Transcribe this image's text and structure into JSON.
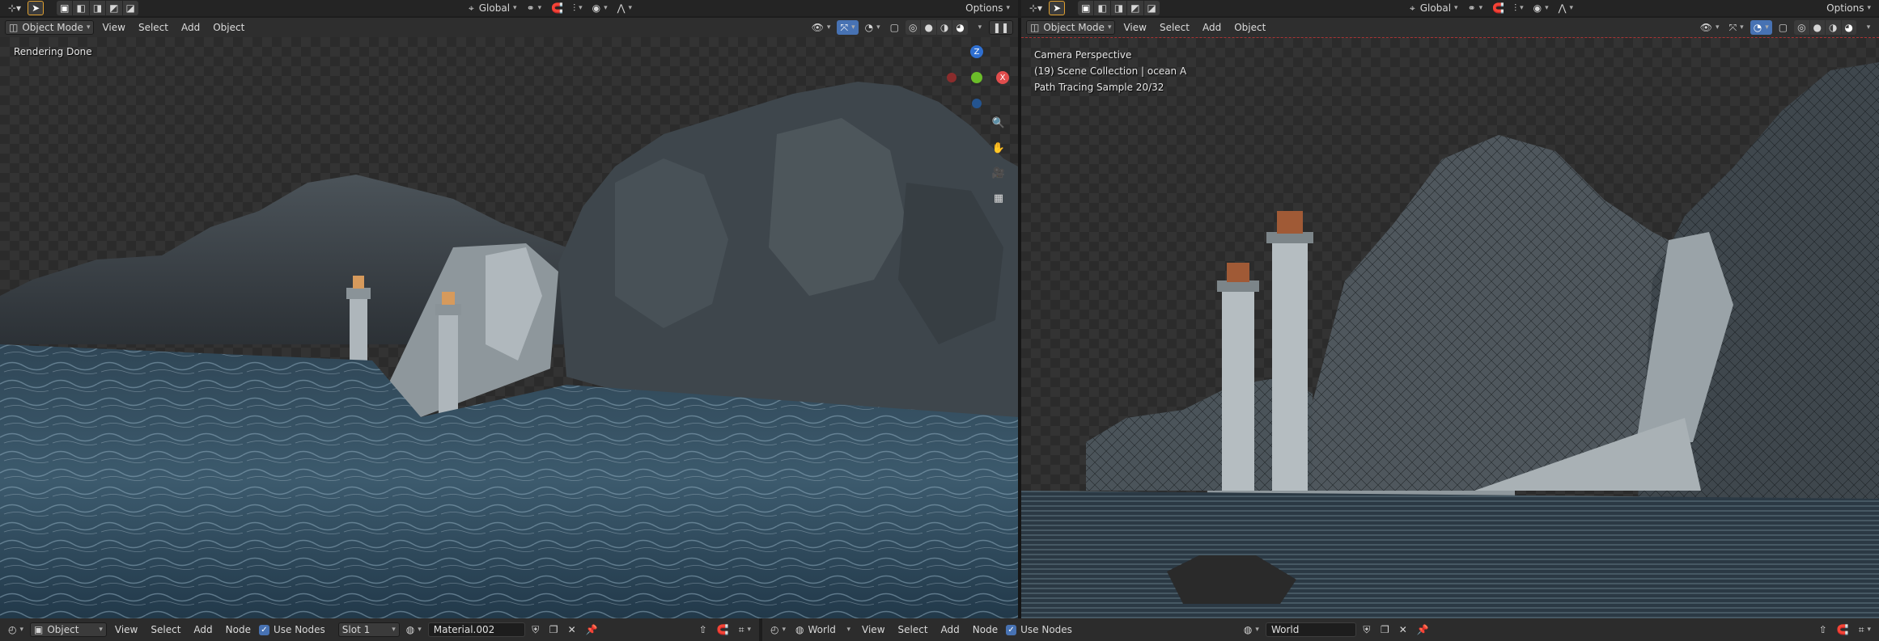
{
  "topbar": {
    "left": {
      "transform_orientation": "Global",
      "options_label": "Options"
    },
    "right": {
      "transform_orientation": "Global",
      "options_label": "Options"
    }
  },
  "left_viewport": {
    "mode": "Object Mode",
    "menus": [
      "View",
      "Select",
      "Add",
      "Object"
    ],
    "overlay_text": "Rendering Done",
    "gizmo_axes": {
      "z": "Z",
      "x": "X"
    }
  },
  "right_viewport": {
    "mode": "Object Mode",
    "menus": [
      "View",
      "Select",
      "Add",
      "Object"
    ],
    "overlay_lines": [
      "Camera Perspective",
      "(19) Scene Collection | ocean A",
      "Path Tracing Sample 20/32"
    ]
  },
  "left_shader_bar": {
    "type": "Object",
    "menus": [
      "View",
      "Select",
      "Add",
      "Node"
    ],
    "use_nodes_label": "Use Nodes",
    "slot": "Slot 1",
    "material": "Material.002"
  },
  "right_shader_bar": {
    "type": "World",
    "menus": [
      "View",
      "Select",
      "Add",
      "Node"
    ],
    "use_nodes_label": "Use Nodes",
    "world": "World"
  }
}
